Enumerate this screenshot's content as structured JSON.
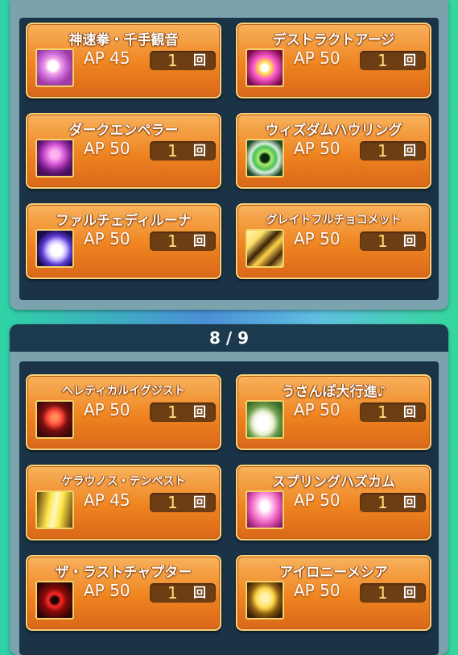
{
  "unit_label": "回",
  "top_panel": {
    "skills": [
      {
        "name": "神速拳・千手観音",
        "ap": "AP 45",
        "count": "1",
        "icon": "sun-mandala-icon",
        "colors": [
          "#f0a3e6",
          "#a03aa0"
        ]
      },
      {
        "name": "デストラクトアージ",
        "ap": "AP 50",
        "count": "1",
        "icon": "sparkle-burst-icon",
        "colors": [
          "#ff5ad0",
          "#7a0a4a"
        ]
      },
      {
        "name": "ダークエンペラー",
        "ap": "AP 50",
        "count": "1",
        "icon": "dark-emperor-icon",
        "colors": [
          "#d75bd8",
          "#4a0f5a"
        ]
      },
      {
        "name": "ウィズダムハウリング",
        "ap": "AP 50",
        "count": "1",
        "icon": "green-eye-icon",
        "colors": [
          "#a8f06a",
          "#1f4a2a"
        ]
      },
      {
        "name": "ファルチェディルーナ",
        "ap": "AP 50",
        "count": "1",
        "icon": "moon-orb-icon",
        "colors": [
          "#ffffff",
          "#3a2aa0"
        ]
      },
      {
        "name": "グレイトフルチョコメット",
        "ap": "AP 50",
        "count": "1",
        "icon": "meteor-shower-icon",
        "colors": [
          "#ffe06a",
          "#4a2a08"
        ]
      }
    ]
  },
  "bottom_panel": {
    "page_indicator": "8 / 9",
    "skills": [
      {
        "name": "ヘレティカルイグジスト",
        "ap": "AP 50",
        "count": "1",
        "icon": "demon-face-icon",
        "colors": [
          "#ff4a3a",
          "#3a0808"
        ]
      },
      {
        "name": "うさんぽ大行進♪",
        "ap": "AP 50",
        "count": "1",
        "icon": "rabbit-icon",
        "colors": [
          "#ffffff",
          "#3a6a2a"
        ]
      },
      {
        "name": "ケラウノス・テンペスト",
        "ap": "AP 45",
        "count": "1",
        "icon": "lightning-icon",
        "colors": [
          "#ffe64a",
          "#5a3a08"
        ]
      },
      {
        "name": "スプリングハズカム",
        "ap": "AP 50",
        "count": "1",
        "icon": "spring-light-icon",
        "colors": [
          "#ff9ae0",
          "#8a1a6a"
        ]
      },
      {
        "name": "ザ・ラストチャプター",
        "ap": "AP 50",
        "count": "1",
        "icon": "red-eye-icon",
        "colors": [
          "#ff2a2a",
          "#2a0606"
        ]
      },
      {
        "name": "アイロニーメシア",
        "ap": "AP 50",
        "count": "1",
        "icon": "golden-figure-icon",
        "colors": [
          "#ffd84a",
          "#3a2006"
        ]
      }
    ]
  }
}
